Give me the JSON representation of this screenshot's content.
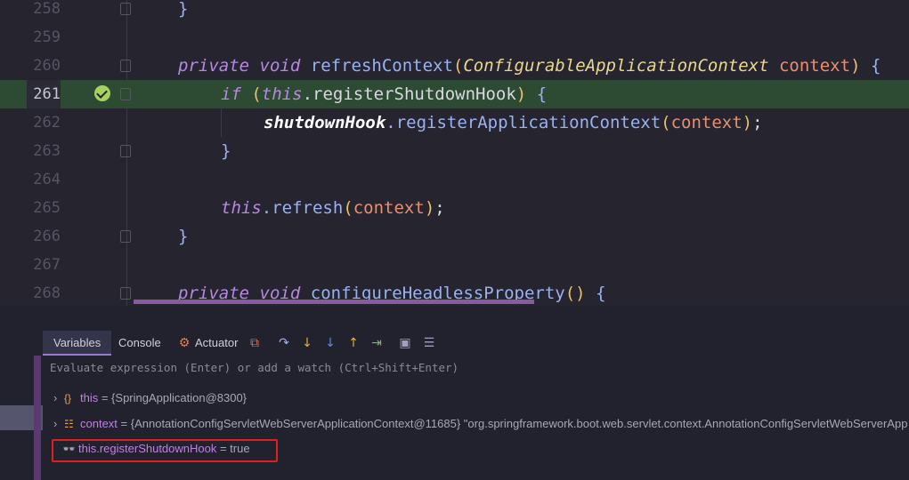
{
  "editor": {
    "lines": [
      {
        "num": "258"
      },
      {
        "num": "259"
      },
      {
        "num": "260"
      },
      {
        "num": "261"
      },
      {
        "num": "262"
      },
      {
        "num": "263"
      },
      {
        "num": "264"
      },
      {
        "num": "265"
      },
      {
        "num": "266"
      },
      {
        "num": "267"
      },
      {
        "num": "268"
      }
    ],
    "tokens": {
      "l258_brace": "}",
      "l260_private": "private",
      "l260_void": "void",
      "l260_name": "refreshContext",
      "l260_open": "(",
      "l260_type": "ConfigurableApplicationContext",
      "l260_param": "context",
      "l260_close": ")",
      "l260_brace": "{",
      "l261_if": "if",
      "l261_open": "(",
      "l261_this": "this",
      "l261_field": ".registerShutdownHook",
      "l261_close": ")",
      "l261_brace": "{",
      "l262_field": "shutdownHook",
      "l262_method": ".registerApplicationContext",
      "l262_open": "(",
      "l262_arg": "context",
      "l262_close": ")",
      "l262_semi": ";",
      "l263_brace": "}",
      "l265_this": "this",
      "l265_method": ".refresh",
      "l265_open": "(",
      "l265_arg": "context",
      "l265_close": ")",
      "l265_semi": ";",
      "l266_brace": "}",
      "l268_private": "private",
      "l268_void": "void",
      "l268_name": "configureHeadlessProperty",
      "l268_parens": "()",
      "l268_brace": "{"
    }
  },
  "debugger": {
    "tabs": [
      {
        "label": "Variables"
      },
      {
        "label": "Console"
      },
      {
        "label": "Actuator"
      }
    ],
    "evaluate_hint": "Evaluate expression (Enter) or add a watch (Ctrl+Shift+Enter)",
    "variables": [
      {
        "name": "this",
        "value": " = {SpringApplication@8300}"
      },
      {
        "name": "context",
        "value": " = {AnnotationConfigServletWebServerApplicationContext@11685} \"org.springframework.boot.web.servlet.context.AnnotationConfigServletWebServerApp"
      }
    ],
    "watch": {
      "name": "this.registerShutdownHook",
      "value": " = true"
    }
  },
  "colors": {
    "highlight_line": "#2d4a32",
    "accent": "#9a7ad0",
    "watch_border": "#e02020"
  }
}
